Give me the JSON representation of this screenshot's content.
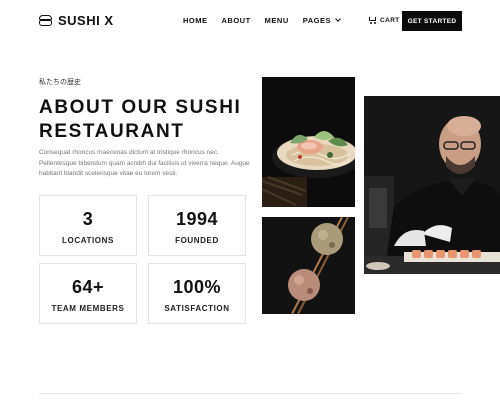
{
  "brand": {
    "name": "SUSHI X"
  },
  "nav": {
    "items": [
      {
        "label": "HOME"
      },
      {
        "label": "ABOUT"
      },
      {
        "label": "MENU"
      },
      {
        "label": "PAGES"
      }
    ],
    "cart_label": "CART",
    "cta_label": "GET STARTED"
  },
  "hero": {
    "eyebrow": "私たちの歴史",
    "title_line1": "ABOUT OUR SUSHI",
    "title_line2": "RESTAURANT",
    "paragraph": "Consequat rhoncus maecenas dictum at tristique rhoncus nec. Pellentesque bibendum quam acnibh dui facilisis ut viverra neque. Augue habitant blandit scelerisque vitae eu lorem vesti."
  },
  "stats": [
    {
      "value": "3",
      "label": "LOCATIONS"
    },
    {
      "value": "1994",
      "label": "FOUNDED"
    },
    {
      "value": "64+",
      "label": "TEAM MEMBERS"
    },
    {
      "value": "100%",
      "label": "SATISFACTION"
    }
  ],
  "images": [
    {
      "icon": "ramen-bowl-photo"
    },
    {
      "icon": "rice-balls-chopsticks-photo"
    },
    {
      "icon": "sushi-chef-photo"
    }
  ],
  "colors": {
    "accent": "#0b0b0b",
    "background": "#ffffff",
    "muted_text": "#777777",
    "border": "#e2e2e2"
  }
}
